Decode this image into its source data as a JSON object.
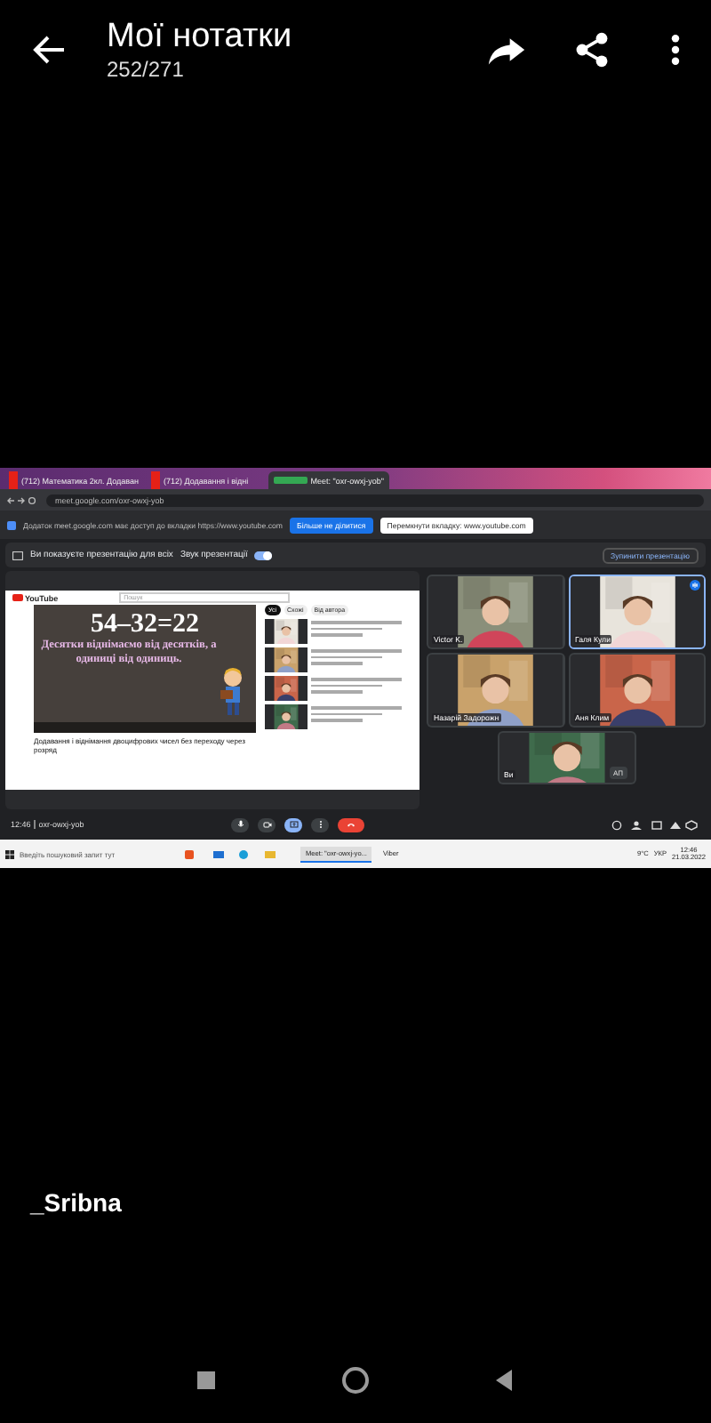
{
  "app_bar": {
    "title": "Мої нотатки",
    "counter": "252/271"
  },
  "screenshot": {
    "browser_tabs": [
      {
        "title": "(712) Математика 2кл. Додаван",
        "selected": false
      },
      {
        "title": "(712) Додавання і відні",
        "selected": false
      },
      {
        "title": "Meet: \"oxr-owxj-yob\"",
        "selected": true
      }
    ],
    "address": "meet.google.com/oxr-owxj-yob",
    "share_bar": {
      "message": "Додаток meet.google.com має доступ до вкладки https://www.youtube.com",
      "stop_button": "Більше не ділитися",
      "switch_button": "Перемкнути вкладку: www.youtube.com"
    },
    "meet": {
      "presenting_notice": "Ви показуєте презентацію для всіх",
      "audio_label": "Звук презентації",
      "audio_on": true,
      "stop_presenting": "Зупинити презентацію",
      "presentation": {
        "logo_text": "YouTube",
        "search_placeholder": "Пошук",
        "video_heading": "54–32=22",
        "video_caption": "Десятки віднімаємо від десятків, а одиниці від одиниць.",
        "video_title": "Додавання і віднімання двоцифрових чисел без переходу через розряд",
        "chips": [
          {
            "label": "Усі",
            "selected": true
          },
          {
            "label": "Схожі",
            "selected": false
          },
          {
            "label": "Від автора",
            "selected": false
          }
        ]
      },
      "participants": [
        {
          "name": "Victor K.",
          "active": false
        },
        {
          "name": "Галя Кули",
          "active": true
        },
        {
          "name": "Назарій Задорожн",
          "active": false
        },
        {
          "name": "Аня Клим",
          "active": false
        },
        {
          "name": "Ви",
          "active": false
        }
      ],
      "language_chip": "АП",
      "time": "12:46",
      "meeting_code": "oxr-owxj-yob",
      "controls": [
        {
          "kind": "mic",
          "selected": false
        },
        {
          "kind": "camera",
          "selected": false
        },
        {
          "kind": "present",
          "selected": true
        },
        {
          "kind": "more",
          "selected": false
        },
        {
          "kind": "hangup",
          "selected": false
        }
      ]
    },
    "taskbar": {
      "search_placeholder": "Введіть пошуковий запит тут",
      "apps": [
        {
          "title": "Meet: \"oxr-owxj-yo...",
          "selected": true
        },
        {
          "title": "Viber",
          "selected": false
        }
      ],
      "weather": "9°C",
      "language": "УКР",
      "time": "12:46",
      "date": "21.03.2022"
    }
  },
  "caption": "_Sribna"
}
